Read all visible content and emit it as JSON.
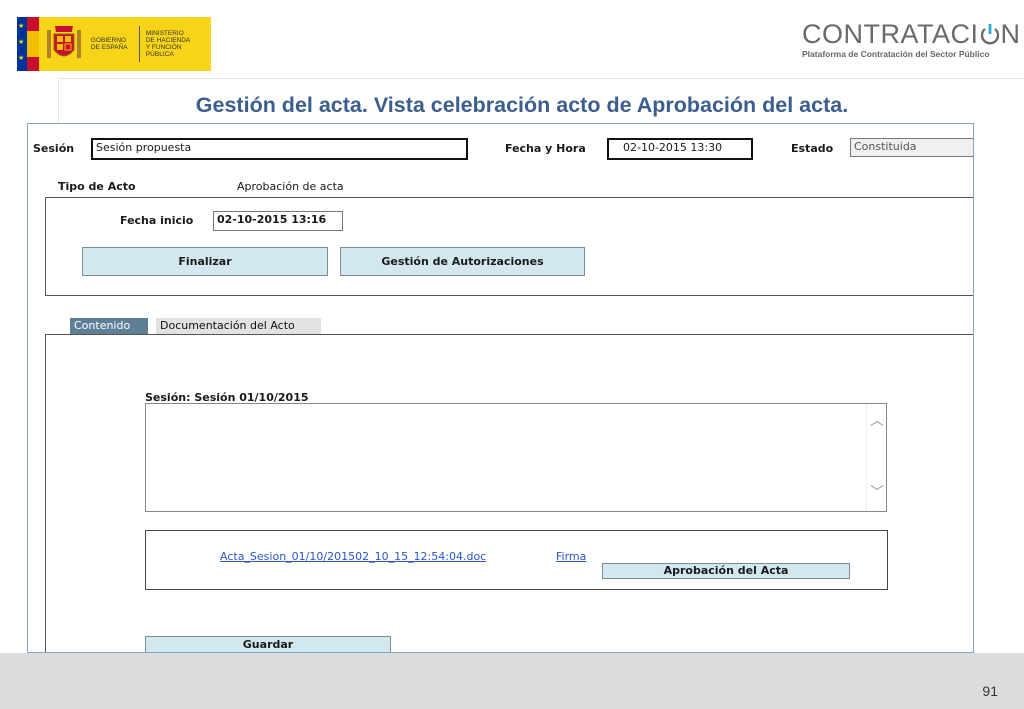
{
  "header": {
    "gov_line1": "GOBIERNO\nDE ESPAÑA",
    "gov_line2": "MINISTERIO\nDE HACIENDA\nY FUNCIÓN PÚBLICA",
    "brand_name": "CONTRATACI",
    "brand_name_end": "N",
    "brand_subtitle": "Plataforma de Contratación del Sector Público",
    "colors": {
      "gov_yellow": "#f7d417",
      "brand_grey": "#6a6a6a",
      "brand_accent": "#2aa7df"
    }
  },
  "slide": {
    "title": "Gestión del acta. Vista celebración acto de Aprobación del acta.",
    "page_number": "91",
    "title_color": "#3b5e8f"
  },
  "app": {
    "session_label": "Sesión",
    "session_value": "Sesión propuesta",
    "datetime_label": "Fecha y Hora",
    "datetime_value": "02-10-2015 13:30",
    "state_label": "Estado",
    "state_value": "Constituida",
    "act_type_label": "Tipo de Acto",
    "act_type_value": "Aprobación de acta",
    "start_date_label": "Fecha inicio",
    "start_date_value": "02-10-2015 13:16",
    "finish_button": "Finalizar",
    "authorizations_button": "Gestión de Autorizaciones",
    "tabs": [
      {
        "label": "Contenido",
        "active": true
      },
      {
        "label": "Documentación del Acto",
        "active": false
      }
    ],
    "content_session_label": "Sesión: Sesión 01/10/2015",
    "document_link": "Acta_Sesion_01/10/201502_10_15_12:54:04.doc",
    "sign_link": "Firma",
    "approve_button": "Aprobación del Acta",
    "save_button": "Guardar"
  }
}
